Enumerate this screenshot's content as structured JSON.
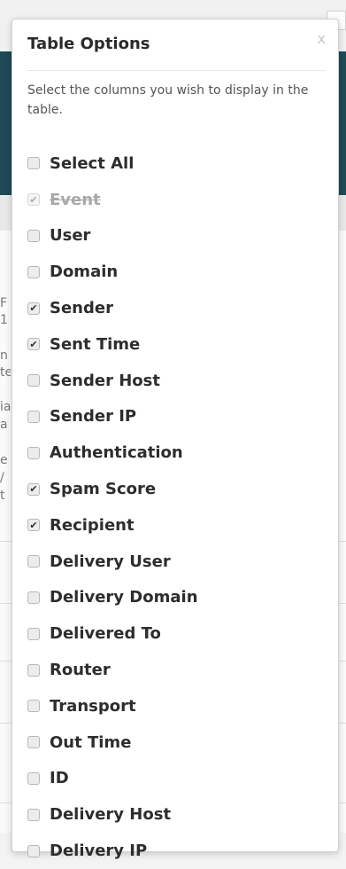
{
  "popover": {
    "title": "Table Options",
    "close_label": "x",
    "description": "Select the columns you wish to display in the table."
  },
  "options": [
    {
      "label": "Select All",
      "checked": false,
      "disabled": false
    },
    {
      "label": "Event",
      "checked": true,
      "disabled": true
    },
    {
      "label": "User",
      "checked": false,
      "disabled": false
    },
    {
      "label": "Domain",
      "checked": false,
      "disabled": false
    },
    {
      "label": "Sender",
      "checked": true,
      "disabled": false
    },
    {
      "label": "Sent Time",
      "checked": true,
      "disabled": false
    },
    {
      "label": "Sender Host",
      "checked": false,
      "disabled": false
    },
    {
      "label": "Sender IP",
      "checked": false,
      "disabled": false
    },
    {
      "label": "Authentication",
      "checked": false,
      "disabled": false
    },
    {
      "label": "Spam Score",
      "checked": true,
      "disabled": false
    },
    {
      "label": "Recipient",
      "checked": true,
      "disabled": false
    },
    {
      "label": "Delivery User",
      "checked": false,
      "disabled": false
    },
    {
      "label": "Delivery Domain",
      "checked": false,
      "disabled": false
    },
    {
      "label": "Delivered To",
      "checked": false,
      "disabled": false
    },
    {
      "label": "Router",
      "checked": false,
      "disabled": false
    },
    {
      "label": "Transport",
      "checked": false,
      "disabled": false
    },
    {
      "label": "Out Time",
      "checked": false,
      "disabled": false
    },
    {
      "label": "ID",
      "checked": false,
      "disabled": false
    },
    {
      "label": "Delivery Host",
      "checked": false,
      "disabled": false
    },
    {
      "label": "Delivery IP",
      "checked": false,
      "disabled": false
    }
  ],
  "background": {
    "fragments": [
      "F",
      "1",
      "n",
      "te",
      "ia",
      "a",
      "e",
      "/",
      "t"
    ],
    "header_color": "#1e4a55"
  }
}
